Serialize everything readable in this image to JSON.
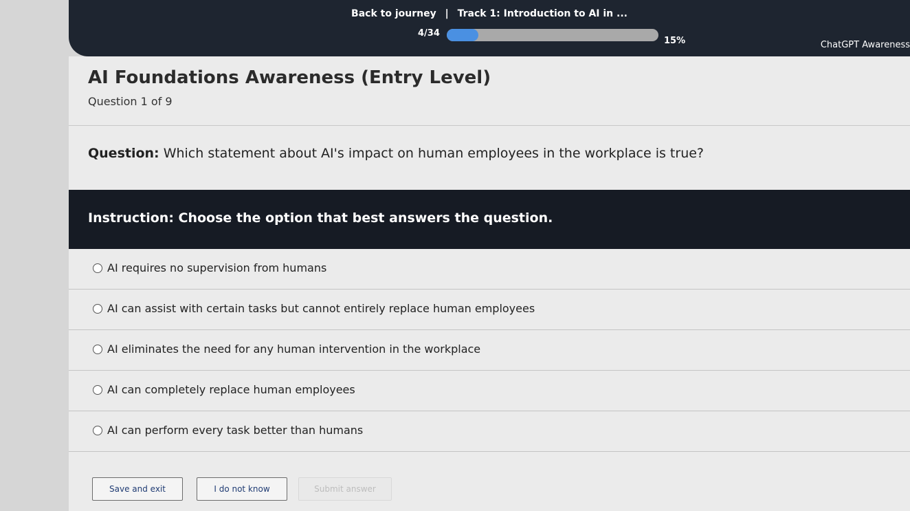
{
  "header": {
    "back_link": "Back to journey",
    "separator": "|",
    "track_title": "Track 1: Introduction to AI in ...",
    "step_counter": "4/34",
    "progress_percent_label": "15%",
    "progress_fraction": 0.15,
    "course_name": "ChatGPT Awareness"
  },
  "quiz": {
    "title": "AI Foundations Awareness (Entry Level)",
    "question_counter": "Question 1 of 9",
    "question_label": "Question:",
    "question_text": "Which statement about AI's impact on human employees in the workplace is true?",
    "instruction_text": "Instruction: Choose the option that best answers the question.",
    "options": [
      "AI requires no supervision from humans",
      "AI can assist with certain tasks but cannot entirely replace human employees",
      "AI eliminates the need for any human intervention in the workplace",
      "AI can completely replace human employees",
      "AI can perform every task better than humans"
    ]
  },
  "buttons": {
    "save_exit": "Save and exit",
    "dont_know": "I do not know",
    "submit": "Submit answer"
  },
  "colors": {
    "header_bg": "#1e2530",
    "instruction_bg": "#161b24",
    "progress_fill": "#4a90e2"
  }
}
